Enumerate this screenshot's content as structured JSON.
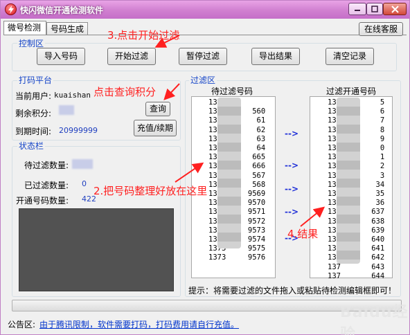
{
  "window": {
    "title": "快闪微信开通检测软件"
  },
  "tabs": [
    {
      "label": "微号检测"
    },
    {
      "label": "号码生成"
    }
  ],
  "service_button": "在线客服",
  "control": {
    "label": "控制区",
    "buttons": [
      "导入号码",
      "开始过滤",
      "暂停过滤",
      "导出结果",
      "清空记录"
    ]
  },
  "platform": {
    "label": "打码平台",
    "user_label": "当前用户:",
    "user_value": "kuaishan",
    "points_label": "剩余积分:",
    "expiry_label": "到期时间:",
    "expiry_value": "20999999",
    "query_button": "查询",
    "recharge_button": "充值/续期"
  },
  "status": {
    "label": "状态栏",
    "pending_label": "待过滤数量:",
    "filtered_label": "已过滤数量:",
    "filtered_value": "0",
    "opened_label": "开通号码数量:",
    "opened_value": "422"
  },
  "filter": {
    "label": "过滤区",
    "left_title": "待过滤号码",
    "right_title": "过滤开通号码",
    "left_numbers": [
      "1373",
      "1373",
      "1373",
      "1373",
      "1373",
      "1373",
      "1373",
      "1373",
      "1373",
      "1373",
      "1373",
      "1373",
      "1373",
      "1373",
      "1373",
      "1373",
      "1373",
      "1373"
    ],
    "left_suffix": [
      "",
      "560",
      "61",
      "62",
      "63",
      "64",
      "665",
      "666",
      "567",
      "568",
      "9569",
      "9570",
      "9571",
      "9572",
      "9573",
      "9574",
      "9575",
      "9576"
    ],
    "right_numbers": [
      "137",
      "137",
      "137",
      "137",
      "137",
      "137",
      "137",
      "137",
      "137",
      "137",
      "137",
      "137",
      "137",
      "137",
      "137",
      "137",
      "137",
      "137"
    ],
    "right_suffix": [
      "5",
      "6",
      "7",
      "8",
      "9",
      "0",
      "1",
      "2",
      "3",
      "34",
      "35",
      "36",
      "637",
      "638",
      "639",
      "640",
      "641",
      "642"
    ],
    "right_tail": [
      "643",
      "644"
    ],
    "arrow": "-->",
    "hint": "提示：将需要过滤的文件拖入或粘贴待检测编辑框即可！"
  },
  "notice": {
    "label": "公告区:",
    "text": "由于腾讯限制，软件需要打码，打码费用请自行充值。"
  },
  "annotations": {
    "step1": "3.点击开始过滤",
    "step2": "点击查询积分",
    "step3": "2.把号码整理好放在这里",
    "step4": "4.结果"
  },
  "watermark": "Baidu经验"
}
